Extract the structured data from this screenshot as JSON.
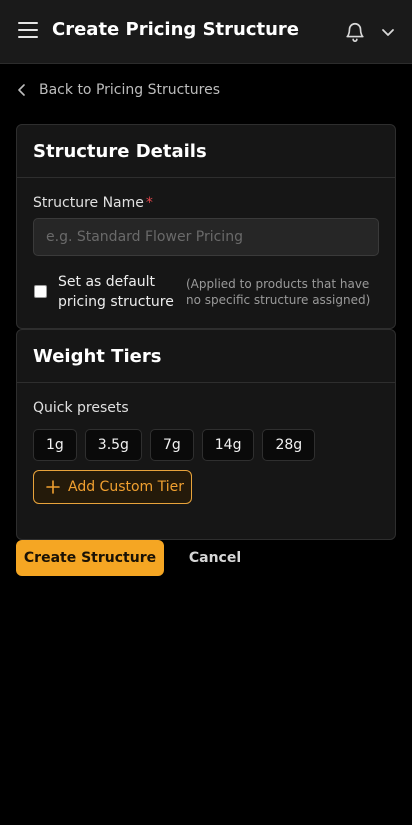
{
  "header": {
    "title": "Create Pricing Structure",
    "icons": {
      "menu": "hamburger-menu-icon",
      "notifications": "bell-icon",
      "account": "chevron-down-icon"
    }
  },
  "nav": {
    "back_label": "Back to Pricing Structures"
  },
  "structure_details": {
    "title": "Structure Details",
    "name_label": "Structure Name",
    "required_mark": "*",
    "name_value": "",
    "name_placeholder": "e.g. Standard Flower Pricing",
    "default_checkbox": {
      "checked": false,
      "label": "Set as default pricing structure",
      "hint": "(Applied to products that have no specific structure assigned)"
    }
  },
  "weight_tiers": {
    "title": "Weight Tiers",
    "presets_label": "Quick presets",
    "presets": [
      "1g",
      "3.5g",
      "7g",
      "14g",
      "28g"
    ],
    "add_custom_label": "Add Custom Tier"
  },
  "actions": {
    "create_label": "Create Structure",
    "cancel_label": "Cancel"
  },
  "colors": {
    "accent": "#f5a623",
    "accent_outline": "#e8a33b",
    "required": "#e5484d",
    "background": "#000000",
    "card": "#161616"
  }
}
